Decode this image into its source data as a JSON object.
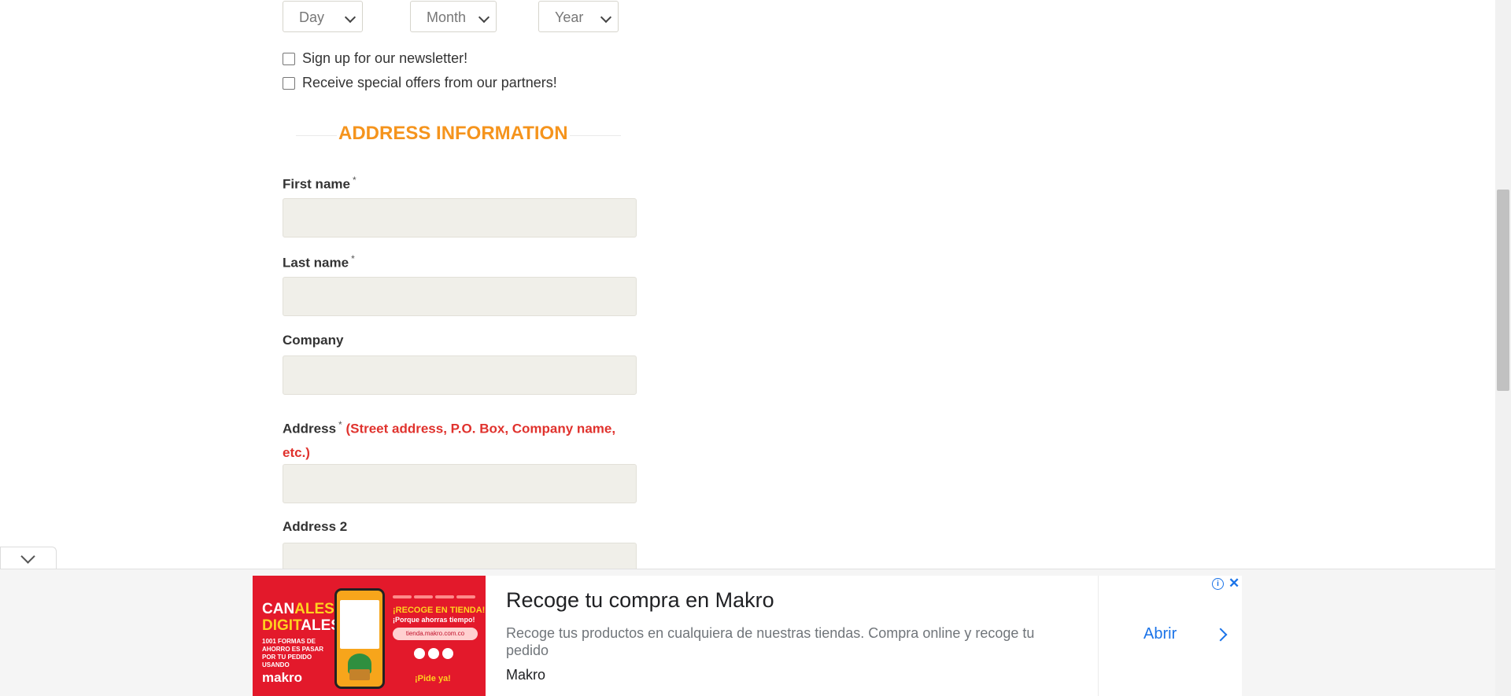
{
  "dob": {
    "day_placeholder": "Day",
    "month_placeholder": "Month",
    "year_placeholder": "Year"
  },
  "checkboxes": {
    "newsletter_label": "Sign up for our newsletter!",
    "partners_label": "Receive special offers from our partners!"
  },
  "section": {
    "title": "ADDRESS INFORMATION"
  },
  "fields": {
    "first_name": {
      "label": "First name",
      "required": "*"
    },
    "last_name": {
      "label": "Last name",
      "required": "*"
    },
    "company": {
      "label": "Company"
    },
    "address": {
      "label": "Address",
      "required": "*",
      "hint_line1": "(Street address, P.O. Box, Company name,",
      "hint_line2": "etc.)"
    },
    "address2": {
      "label": "Address 2"
    }
  },
  "ad": {
    "title": "Recoge tu compra en Makro",
    "description": "Recoge tus productos en cualquiera de nuestras tiendas. Compra online y recoge tu pedido",
    "advertiser": "Makro",
    "cta": "Abrir",
    "info_icon": "info-icon",
    "close_icon": "close-icon",
    "image": {
      "brand_part1": "CAN",
      "brand_part1_accent": "ALES",
      "brand_part2": "DIGIT",
      "brand_part2_accent": "ALES",
      "small_text": "1001 FORMAS DE AHORRO ES PASAR POR TU PEDIDO USANDO",
      "logo": "makro",
      "promo_headline": "¡RECOGE EN TIENDA!",
      "promo_sub": "¡Porque ahorras tiempo!",
      "promo_url": "tienda.makro.com.co",
      "promo_cta": "¡Pide ya!"
    }
  },
  "colors": {
    "section_title": "#f5941d",
    "hint": "#e0322d",
    "input_bg": "#f0efe9",
    "ad_link": "#1a73e8",
    "ad_image_bg": "#e3192b"
  }
}
